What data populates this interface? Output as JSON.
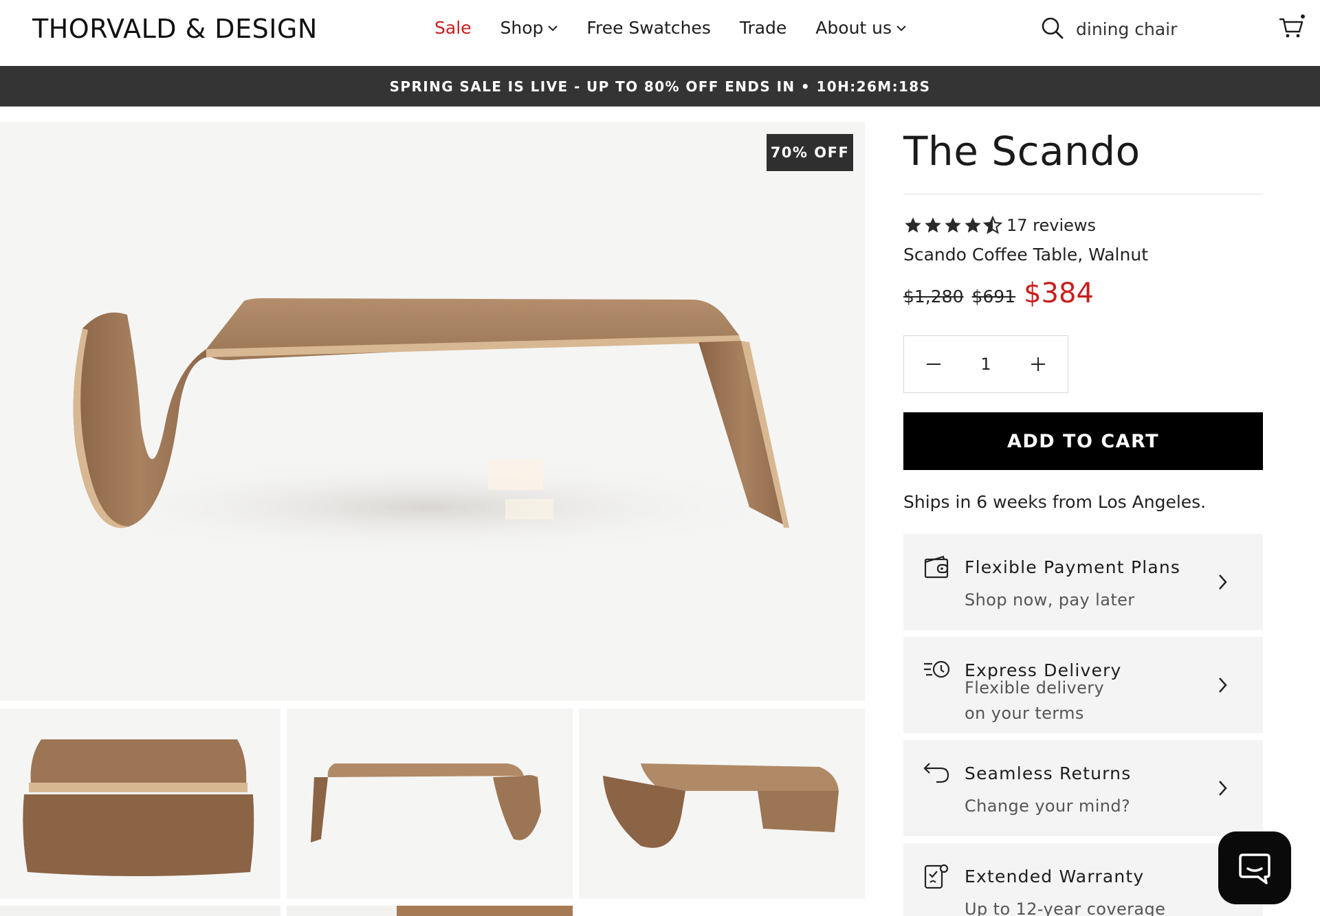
{
  "header": {
    "logo": "THORVALD & DESIGN",
    "nav": {
      "sale": "Sale",
      "shop": "Shop",
      "swatches": "Free Swatches",
      "trade": "Trade",
      "about": "About us"
    },
    "search_value": "dining chair",
    "icons": [
      "search-icon",
      "cart-icon",
      "chevron-down-icon"
    ]
  },
  "promo": {
    "text": "SPRING SALE IS LIVE - UP TO 80% OFF ENDS IN • 10H:26M:18S"
  },
  "gallery": {
    "badge": "70% OFF"
  },
  "product": {
    "title": "The Scando",
    "rating": 4.5,
    "reviews": "17 reviews",
    "subtitle": "Scando Coffee Table, Walnut",
    "price_original": "$1,280",
    "price_previous": "$691",
    "price_current": "$384",
    "quantity": "1",
    "add_to_cart": "ADD TO CART",
    "shipping": "Ships in 6 weeks from Los Angeles."
  },
  "features": [
    {
      "icon": "wallet-icon",
      "title": "Flexible Payment Plans",
      "subtitle": "Shop now, pay later"
    },
    {
      "icon": "fast-delivery-icon",
      "title": "Express Delivery",
      "subtitle_line1": "Flexible delivery",
      "subtitle_line2": "on your terms"
    },
    {
      "icon": "return-arrow-icon",
      "title": "Seamless Returns",
      "subtitle": "Change your mind?"
    },
    {
      "icon": "warranty-icon",
      "title": "Extended Warranty",
      "subtitle": "Up to 12-year coverage"
    }
  ],
  "colors": {
    "sale_red": "#c81e1e",
    "promo_bar": "#343434",
    "button_black": "#000000",
    "feature_bg": "#f4f4f4",
    "image_bg": "#f5f5f4",
    "walnut": "#a57a55"
  }
}
